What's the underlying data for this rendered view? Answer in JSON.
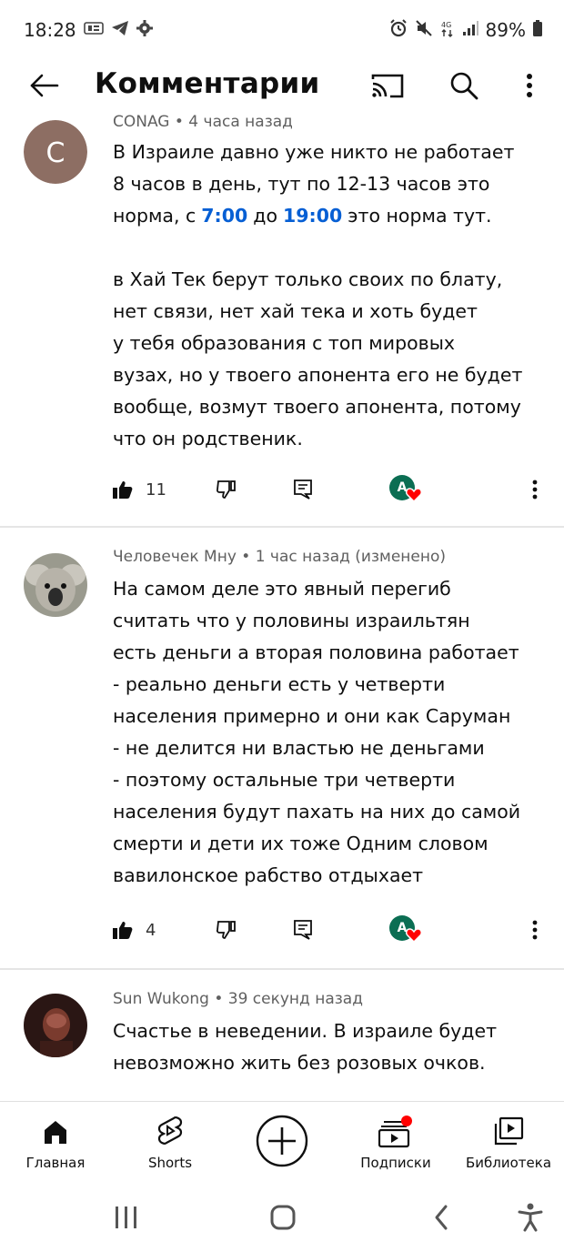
{
  "status_bar": {
    "time": "18:28",
    "left_icons": [
      "sim-icon",
      "telegram-icon",
      "settings-gear-icon"
    ],
    "right_icons": [
      "alarm-icon",
      "mute-icon",
      "4g-icon",
      "signal-icon"
    ],
    "battery": "89%"
  },
  "header": {
    "title": "Комментарии"
  },
  "comments": [
    {
      "author_line": "CONAG • 4 часа назад",
      "avatar_letter": "C",
      "avatar_color": "#8d6e63",
      "paragraph1_lines": [
        "В Израиле давно уже никто не работает",
        "8 часов в день, тут по 12-13 часов это"
      ],
      "line3_pre": "норма, с",
      "ts1": "7:00",
      "line3_mid": "до",
      "ts2": "19:00",
      "line3_post": "это норма тут.",
      "paragraph2_lines": [
        "в Хай Тек берут только своих по блату,",
        "нет связи, нет хай тека и хоть будет",
        "у тебя образования с топ мировых",
        "вузах, но у твоего апонента его не будет",
        "вообще, возмут твоего апонента, потому",
        "что он родственик."
      ],
      "likes": "11",
      "creator_letter": "A"
    },
    {
      "author_line": "Человечек Мну • 1 час назад (изменено)",
      "text_lines": [
        "На самом деле это явный перегиб",
        "считать что у половины израильтян",
        "есть деньги а вторая половина работает",
        "- реально деньги есть у четверти",
        "населения примерно и они как Саруман",
        "- не делится ни властью не деньгами",
        "- поэтому остальные три четверти",
        "населения будут пахать на них до самой",
        "смерти и дети их тоже Одним словом",
        "вавилонское рабство отдыхает"
      ],
      "likes": "4",
      "creator_letter": "A"
    },
    {
      "author_line": "Sun Wukong • 39 секунд назад",
      "text_lines": [
        "Счастье в неведении.  В израиле будет",
        "невозможно жить без розовых очков."
      ]
    }
  ],
  "bottom_nav": {
    "home": "Главная",
    "shorts": "Shorts",
    "subscriptions": "Подписки",
    "library": "Библиотека"
  },
  "colors": {
    "accent_link": "#065fd4",
    "badge_red": "#ff0000",
    "creator_green": "#0b6e53"
  }
}
